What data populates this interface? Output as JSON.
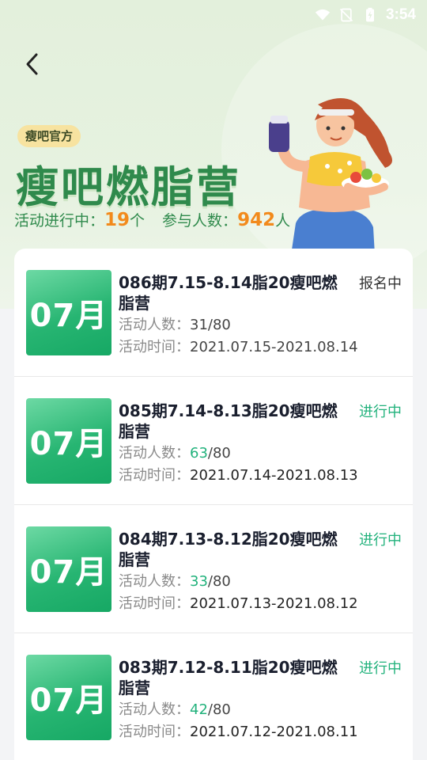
{
  "status_bar": {
    "time": "3:54",
    "icons": [
      "wifi-icon",
      "no-signal-icon",
      "battery-charging-icon"
    ]
  },
  "header": {
    "back_icon": "chevron-left-icon",
    "tag": "瘦吧官方",
    "title": "瘦吧燃脂营",
    "stats": {
      "active_label": "活动进行中：",
      "active_count": "19",
      "active_unit": "个",
      "participants_label": "参与人数：",
      "participants_count": "942",
      "participants_unit": "人"
    }
  },
  "colors": {
    "brand_green": "#2f8a4c",
    "accent_orange": "#f28a1c",
    "status_green": "#22b27c"
  },
  "items": [
    {
      "thumb": "07月",
      "title": "086期7.15-8.14脂20瘦吧燃脂营",
      "status": "报名中",
      "count_label": "活动人数：",
      "count_current": "31",
      "count_total": "/80",
      "time_label": "活动时间：",
      "time_value": "2021.07.15-2021.08.14"
    },
    {
      "thumb": "07月",
      "title": "085期7.14-8.13脂20瘦吧燃脂营",
      "status": "进行中",
      "count_label": "活动人数：",
      "count_current": "63",
      "count_total": "/80",
      "time_label": "活动时间：",
      "time_value": "2021.07.14-2021.08.13"
    },
    {
      "thumb": "07月",
      "title": "084期7.13-8.12脂20瘦吧燃脂营",
      "status": "进行中",
      "count_label": "活动人数：",
      "count_current": "33",
      "count_total": "/80",
      "time_label": "活动时间：",
      "time_value": "2021.07.13-2021.08.12"
    },
    {
      "thumb": "07月",
      "title": "083期7.12-8.11脂20瘦吧燃脂营",
      "status": "进行中",
      "count_label": "活动人数：",
      "count_current": "42",
      "count_total": "/80",
      "time_label": "活动时间：",
      "time_value": "2021.07.12-2021.08.11"
    }
  ]
}
